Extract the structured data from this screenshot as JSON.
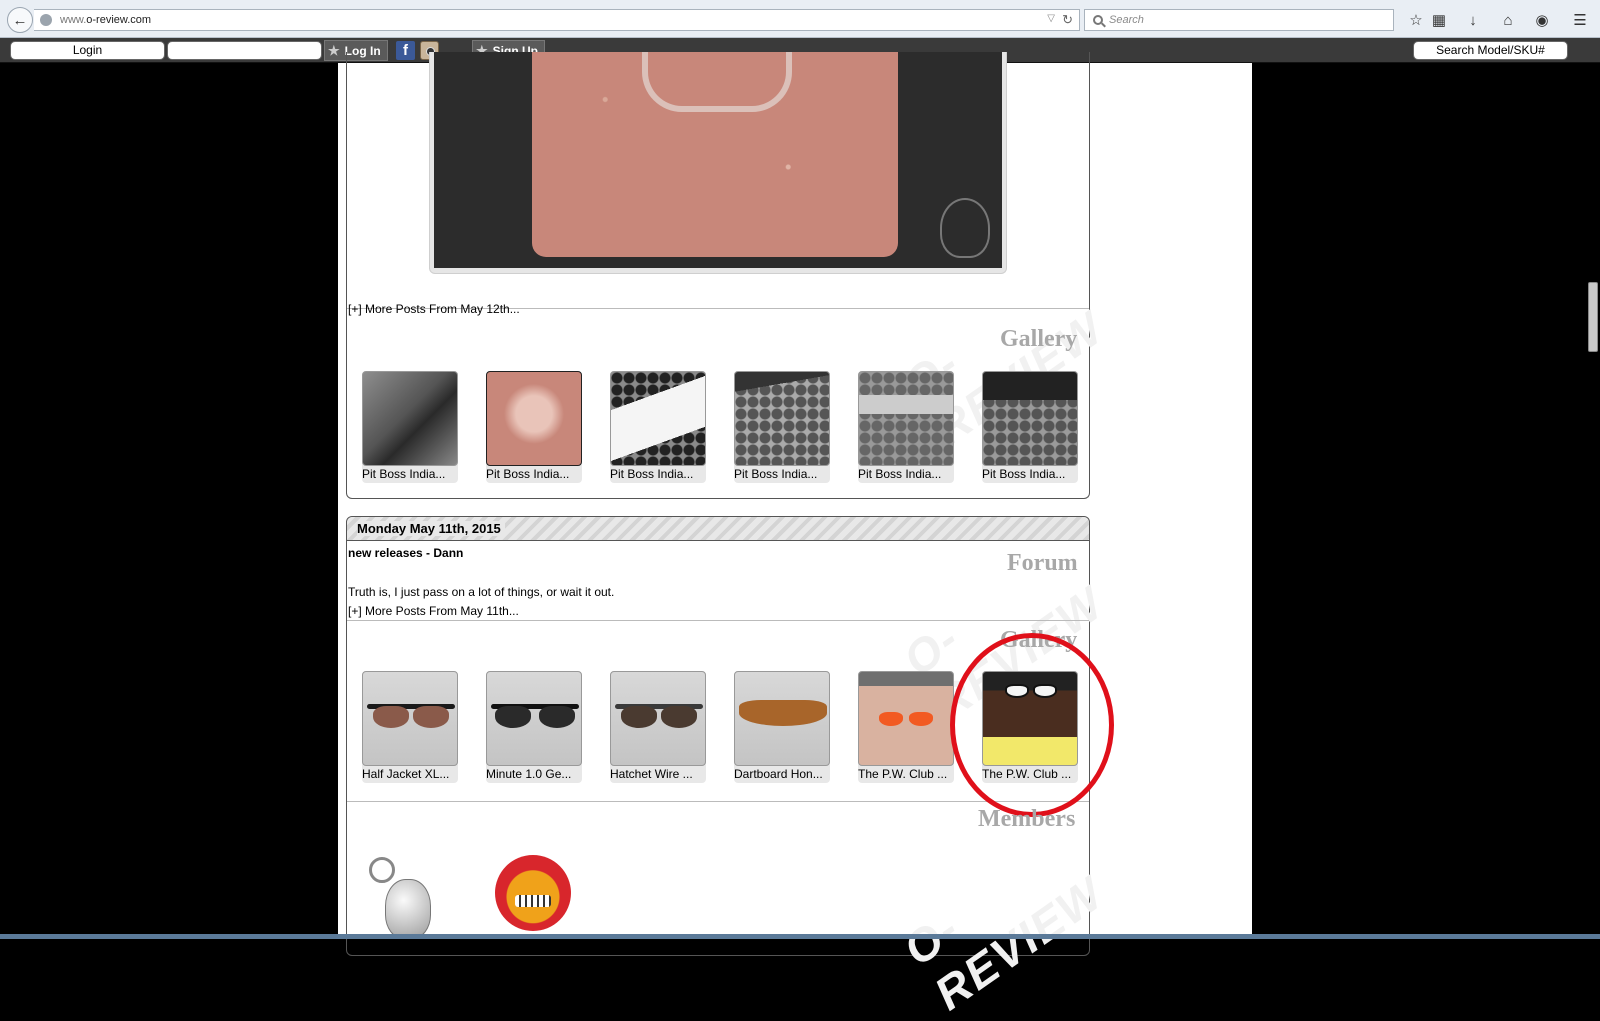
{
  "browser": {
    "url_prefix": "www.",
    "url_domain": "o-review.com",
    "search_placeholder": "Search"
  },
  "site_bar": {
    "login_label": "Login",
    "log_in_button": "Log In",
    "sign_up_button": "Sign Up",
    "search_model_label": "Search Model/SKU#"
  },
  "day1": {
    "more_posts": "[+] More Posts From May 12th...",
    "gallery_title": "Gallery",
    "gallery": [
      {
        "caption": "Pit Boss India..."
      },
      {
        "caption": "Pit Boss India..."
      },
      {
        "caption": "Pit Boss India..."
      },
      {
        "caption": "Pit Boss India..."
      },
      {
        "caption": "Pit Boss India..."
      },
      {
        "caption": "Pit Boss India..."
      }
    ]
  },
  "day2": {
    "date": "Monday May 11th, 2015",
    "forum_title": "Forum",
    "post_title": "new releases - Dann",
    "post_body": "Truth is, I just pass on a lot of things, or wait it out.",
    "more_posts": "[+] More Posts From May 11th...",
    "gallery_title": "Gallery",
    "gallery": [
      {
        "caption": "Half Jacket XL..."
      },
      {
        "caption": "Minute 1.0 Ge..."
      },
      {
        "caption": "Hatchet Wire ..."
      },
      {
        "caption": "Dartboard Hon..."
      },
      {
        "caption": "The P.W. Club ..."
      },
      {
        "caption": "The P.W. Club ..."
      }
    ],
    "members_title": "Members"
  },
  "watermark_text": "O-REVIEW",
  "highlight_color": "#e0101a"
}
